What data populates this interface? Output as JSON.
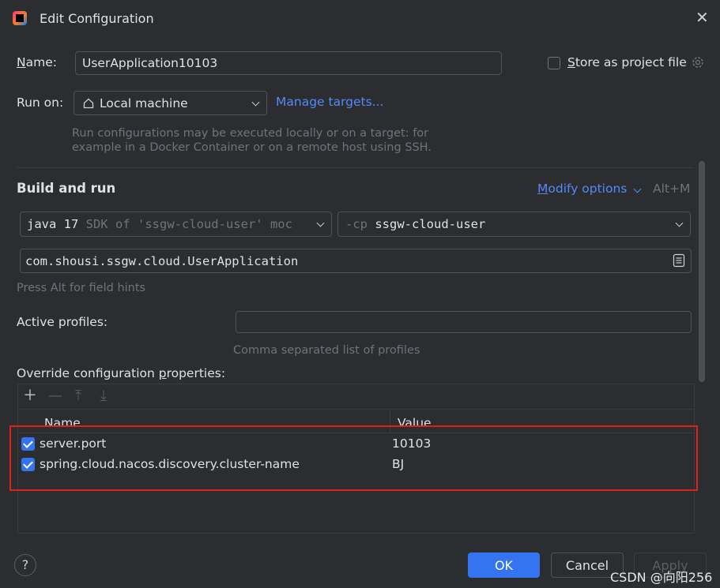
{
  "window": {
    "title": "Edit Configuration"
  },
  "name_row": {
    "label_prefix": "N",
    "label_rest": "ame:",
    "value": "UserApplication10103",
    "store_prefix": "S",
    "store_rest": "tore as project file",
    "store_checked": false
  },
  "run_on": {
    "label": "Run on:",
    "target": "Local machine",
    "manage_link": "Manage targets...",
    "hint_line1": "Run configurations may be executed locally or on a target: for",
    "hint_line2": "example in a Docker Container or on a remote host using SSH."
  },
  "build_and_run": {
    "heading": "Build and run",
    "modify_prefix": "M",
    "modify_rest": "odify options",
    "modify_shortcut": "Alt+M",
    "sdk_value": "java 17",
    "sdk_hint": "SDK of 'ssgw-cloud-user' moc",
    "cp_prefix": "-cp",
    "cp_value": "ssgw-cloud-user",
    "main_class": "com.shousi.ssgw.cloud.UserApplication",
    "field_hints": "Press Alt for field hints"
  },
  "profiles": {
    "label": "Active profiles:",
    "value": "",
    "hint": "Comma separated list of profiles"
  },
  "override": {
    "label_before": "Override configuration ",
    "label_underlined": "p",
    "label_after": "roperties:",
    "col_name": "Name",
    "col_value": "Value",
    "rows": [
      {
        "key": "server.port",
        "value": "10103",
        "enabled": true
      },
      {
        "key": "spring.cloud.nacos.discovery.cluster-name",
        "value": "BJ",
        "enabled": true
      }
    ]
  },
  "buttons": {
    "help": "?",
    "ok": "OK",
    "cancel": "Cancel",
    "apply": "Apply"
  },
  "watermark": "CSDN @向阳256",
  "colors": {
    "accent": "#3574f0",
    "link": "#548af7",
    "highlight_box": "#e0201b",
    "background": "#2b2d30"
  }
}
